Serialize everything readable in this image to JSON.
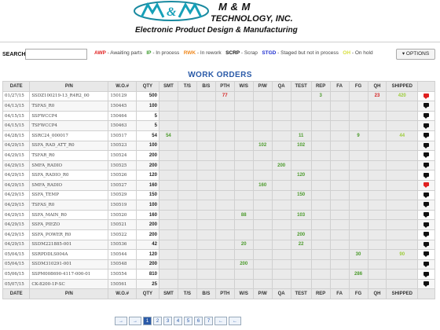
{
  "company": {
    "logo_text": "M&M",
    "name": "M & M",
    "sub": "TECHNOLOGY, INC.",
    "tagline": "Electronic Product Design & Manufacturing"
  },
  "search": {
    "label": "SEARCH:",
    "value": ""
  },
  "legend": [
    {
      "code": "AWP",
      "desc": " - Awaiting parts",
      "color": "#e02020"
    },
    {
      "code": "IP",
      "desc": " - In process",
      "color": "#3a9a2a"
    },
    {
      "code": "RWK",
      "desc": " - In rework",
      "color": "#f08a20"
    },
    {
      "code": "SCRP",
      "desc": " - Scrap",
      "color": "#111111"
    },
    {
      "code": "STGD",
      "desc": " - Staged but not in process",
      "color": "#2030d0"
    },
    {
      "code": "OH",
      "desc": " - On hold",
      "color": "#d8e040"
    }
  ],
  "options_label": "▾ OPTIONS",
  "title": "WORK ORDERS",
  "columns": [
    "DATE",
    "P/N",
    "W.O.#",
    "QTY",
    "SMT",
    "T/S",
    "B/S",
    "PTH",
    "W/S",
    "P/W",
    "QA",
    "TEST",
    "REP",
    "FA",
    "FG",
    "QH",
    "SHIPPED",
    ""
  ],
  "rows": [
    {
      "date": "01/27/15",
      "pn": "SSDZ100219-13_R4R2_00",
      "wo": "150129",
      "qty": "500",
      "cells": {
        "PTH": [
          "77",
          "red"
        ],
        "REP": [
          "3",
          "green"
        ],
        "QH": [
          "23",
          "red"
        ],
        "SHIPPED": [
          "420",
          "ltgreen"
        ]
      },
      "flag": "red"
    },
    {
      "date": "04/13/15",
      "pn": "TSFAS_R0",
      "wo": "150445",
      "qty": "100",
      "cells": {},
      "flag": "black"
    },
    {
      "date": "04/15/15",
      "pn": "SSFWCCP4",
      "wo": "150464",
      "qty": "5",
      "cells": {},
      "flag": "black"
    },
    {
      "date": "04/15/15",
      "pn": "TSFWCCP4",
      "wo": "150463",
      "qty": "5",
      "cells": {},
      "flag": "black"
    },
    {
      "date": "04/28/15",
      "pn": "SSRC24_000017",
      "wo": "150517",
      "qty": "54",
      "cells": {
        "SMT": [
          "54",
          "green"
        ],
        "TEST": [
          "11",
          "green"
        ],
        "FG": [
          "9",
          "green"
        ],
        "SHIPPED": [
          "44",
          "ltgreen"
        ]
      },
      "flag": "black"
    },
    {
      "date": "04/29/15",
      "pn": "SSFA_RAD_ATT_R0",
      "wo": "150523",
      "qty": "100",
      "cells": {
        "P/W": [
          "102",
          "green"
        ],
        "TEST": [
          "102",
          "green"
        ]
      },
      "flag": "black"
    },
    {
      "date": "04/29/15",
      "pn": "TSFAR_R0",
      "wo": "150524",
      "qty": "200",
      "cells": {},
      "flag": "black"
    },
    {
      "date": "04/29/15",
      "pn": "SMFA_RADIO",
      "wo": "150525",
      "qty": "200",
      "cells": {
        "QA": [
          "200",
          "green"
        ]
      },
      "flag": "black"
    },
    {
      "date": "04/29/15",
      "pn": "SSFA_RADIO_R0",
      "wo": "150526",
      "qty": "120",
      "cells": {
        "TEST": [
          "120",
          "green"
        ]
      },
      "flag": "black"
    },
    {
      "date": "04/29/15",
      "pn": "SMFA_RADIO",
      "wo": "150527",
      "qty": "160",
      "cells": {
        "P/W": [
          "160",
          "green"
        ]
      },
      "flag": "red"
    },
    {
      "date": "04/29/15",
      "pn": "SSFA_TEMP",
      "wo": "150529",
      "qty": "150",
      "cells": {
        "TEST": [
          "150",
          "green"
        ]
      },
      "flag": "black"
    },
    {
      "date": "04/29/15",
      "pn": "TSFAS_R0",
      "wo": "150519",
      "qty": "100",
      "cells": {},
      "flag": "black"
    },
    {
      "date": "04/29/15",
      "pn": "SSFA_MAIN_R0",
      "wo": "150520",
      "qty": "160",
      "cells": {
        "W/S": [
          "88",
          "green"
        ],
        "TEST": [
          "103",
          "green"
        ]
      },
      "flag": "black"
    },
    {
      "date": "04/29/15",
      "pn": "SSFA_PIEZO",
      "wo": "150521",
      "qty": "200",
      "cells": {},
      "flag": "black"
    },
    {
      "date": "04/29/15",
      "pn": "SSFA_POWER_R0",
      "wo": "150522",
      "qty": "200",
      "cells": {
        "TEST": [
          "200",
          "green"
        ]
      },
      "flag": "black"
    },
    {
      "date": "04/29/15",
      "pn": "SSDM221885-001",
      "wo": "150536",
      "qty": "42",
      "cells": {
        "W/S": [
          "20",
          "green"
        ],
        "TEST": [
          "22",
          "green"
        ]
      },
      "flag": "black"
    },
    {
      "date": "05/04/15",
      "pn": "SSRPDDLS004A",
      "wo": "150544",
      "qty": "120",
      "cells": {
        "FG": [
          "30",
          "green"
        ],
        "SHIPPED": [
          "90",
          "ltgreen"
        ]
      },
      "flag": "black"
    },
    {
      "date": "05/04/15",
      "pn": "SSDM310291-001",
      "wo": "150548",
      "qty": "200",
      "cells": {
        "W/S": [
          "200",
          "green"
        ]
      },
      "flag": "black"
    },
    {
      "date": "05/06/15",
      "pn": "SSPM008690-4117-000-01",
      "wo": "150554",
      "qty": "810",
      "cells": {
        "FG": [
          "286",
          "green"
        ]
      },
      "flag": "black"
    },
    {
      "date": "05/07/15",
      "pn": "CK-8200-1P-SC",
      "wo": "150561",
      "qty": "25",
      "cells": {},
      "flag": "black"
    }
  ],
  "pager": [
    "→",
    "→",
    "1",
    "2",
    "3",
    "4",
    "5",
    "6",
    "7",
    "←",
    "←"
  ],
  "pager_active": "1",
  "flag_colors": {
    "red": "#e02020",
    "black": "#111111"
  },
  "cell_colors": {
    "green": "#4a9a2a",
    "red": "#d42020",
    "ltgreen": "#9ccc3a"
  }
}
